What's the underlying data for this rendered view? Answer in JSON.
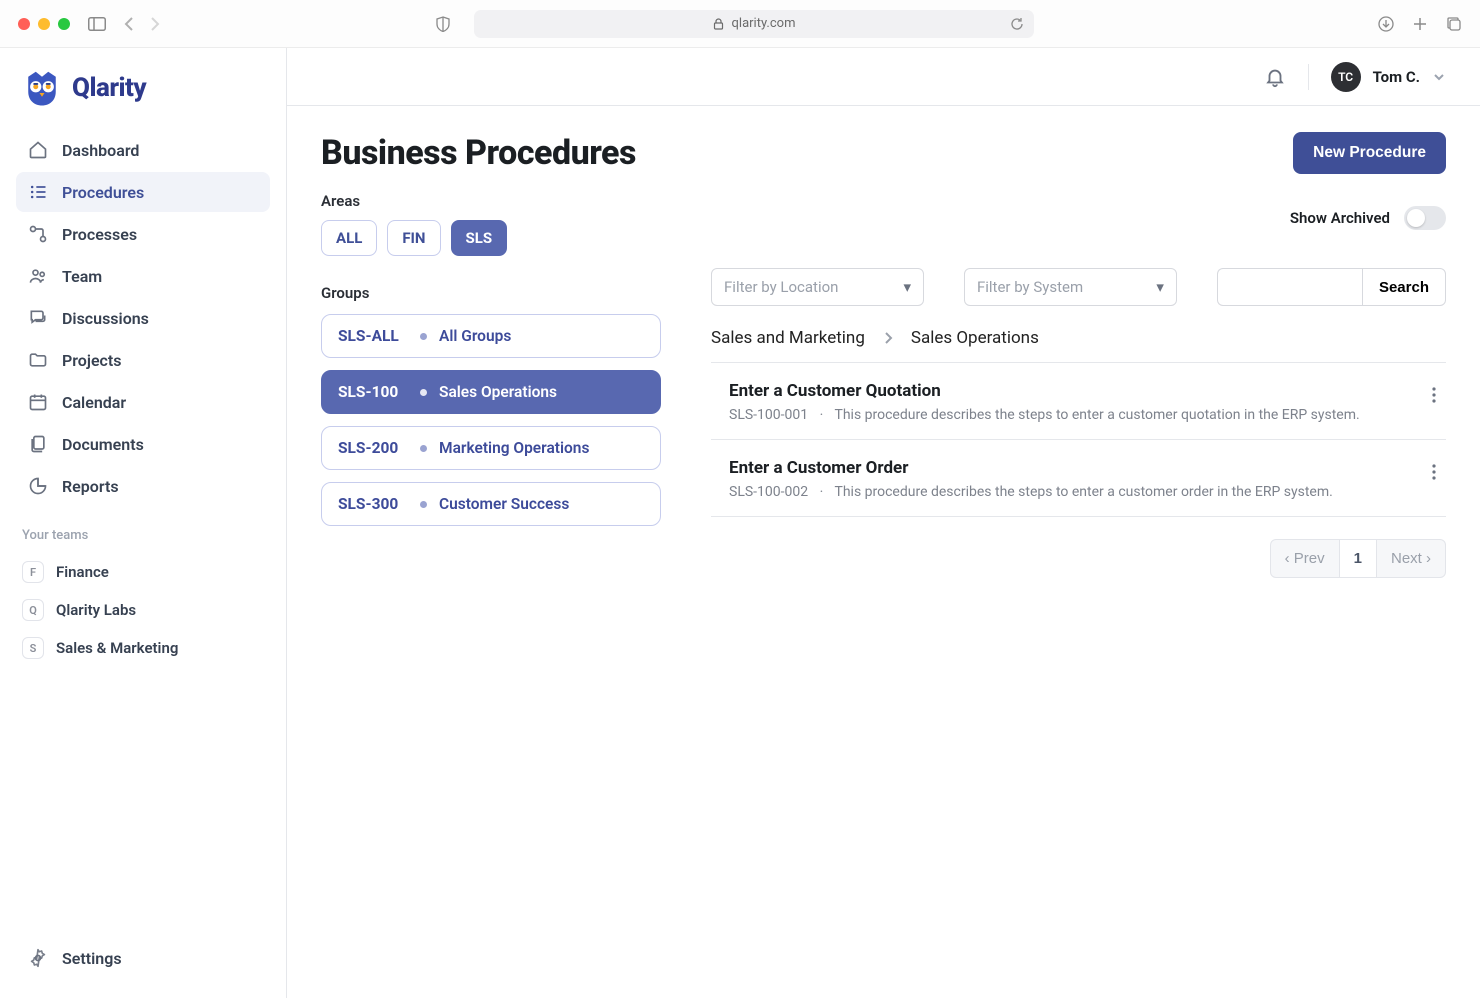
{
  "browser": {
    "url": "qlarity.com"
  },
  "app_name": "Qlarity",
  "user": {
    "initials": "TC",
    "display_name": "Tom C."
  },
  "sidebar": {
    "items": [
      {
        "label": "Dashboard"
      },
      {
        "label": "Procedures"
      },
      {
        "label": "Processes"
      },
      {
        "label": "Team"
      },
      {
        "label": "Discussions"
      },
      {
        "label": "Projects"
      },
      {
        "label": "Calendar"
      },
      {
        "label": "Documents"
      },
      {
        "label": "Reports"
      }
    ],
    "teams_header": "Your teams",
    "teams": [
      {
        "initial": "F",
        "name": "Finance"
      },
      {
        "initial": "Q",
        "name": "Qlarity Labs"
      },
      {
        "initial": "S",
        "name": "Sales & Marketing"
      }
    ],
    "settings_label": "Settings"
  },
  "page": {
    "title": "Business Procedures",
    "new_button": "New Procedure",
    "areas_label": "Areas",
    "area_chips": [
      {
        "label": "ALL"
      },
      {
        "label": "FIN"
      },
      {
        "label": "SLS"
      }
    ],
    "groups_label": "Groups",
    "groups": [
      {
        "code": "SLS-ALL",
        "name": "All Groups"
      },
      {
        "code": "SLS-100",
        "name": "Sales Operations"
      },
      {
        "code": "SLS-200",
        "name": "Marketing Operations"
      },
      {
        "code": "SLS-300",
        "name": "Customer Success"
      }
    ],
    "archived_label": "Show Archived",
    "filters": {
      "location_placeholder": "Filter by Location",
      "system_placeholder": "Filter by System",
      "search_button": "Search"
    },
    "breadcrumb": [
      "Sales and Marketing",
      "Sales Operations"
    ],
    "procedures": [
      {
        "title": "Enter a Customer Quotation",
        "code": "SLS-100-001",
        "desc": "This procedure describes the steps to enter a customer quotation in the ERP system."
      },
      {
        "title": "Enter a Customer Order",
        "code": "SLS-100-002",
        "desc": "This procedure describes the steps to enter a customer order in the ERP system."
      }
    ],
    "pager": {
      "prev": "‹ Prev",
      "page": "1",
      "next": "Next ›"
    }
  }
}
